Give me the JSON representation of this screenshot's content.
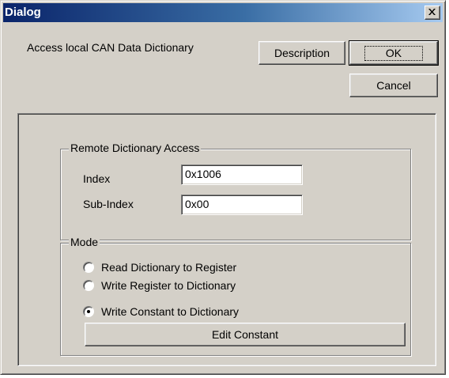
{
  "window": {
    "title": "Dialog",
    "close_glyph": "×"
  },
  "header": {
    "description": "Access local CAN Data Dictionary"
  },
  "buttons": {
    "description": "Description",
    "ok": "OK",
    "cancel": "Cancel",
    "edit_constant": "Edit Constant"
  },
  "remote_access": {
    "legend": "Remote Dictionary Access",
    "index_label": "Index",
    "index_value": "0x1006",
    "subindex_label": "Sub-Index",
    "subindex_value": "0x00"
  },
  "mode": {
    "legend": "Mode",
    "options": [
      {
        "label": "Read Dictionary to Register",
        "checked": false
      },
      {
        "label": "Write Register to Dictionary",
        "checked": false
      },
      {
        "label": "Write Constant to Dictionary",
        "checked": true
      }
    ]
  },
  "icons": {
    "close": "close-icon",
    "radio": "radio-icon"
  },
  "colors": {
    "face": "#d4d0c8",
    "title_start": "#0a246a",
    "title_end": "#a6caf0"
  }
}
